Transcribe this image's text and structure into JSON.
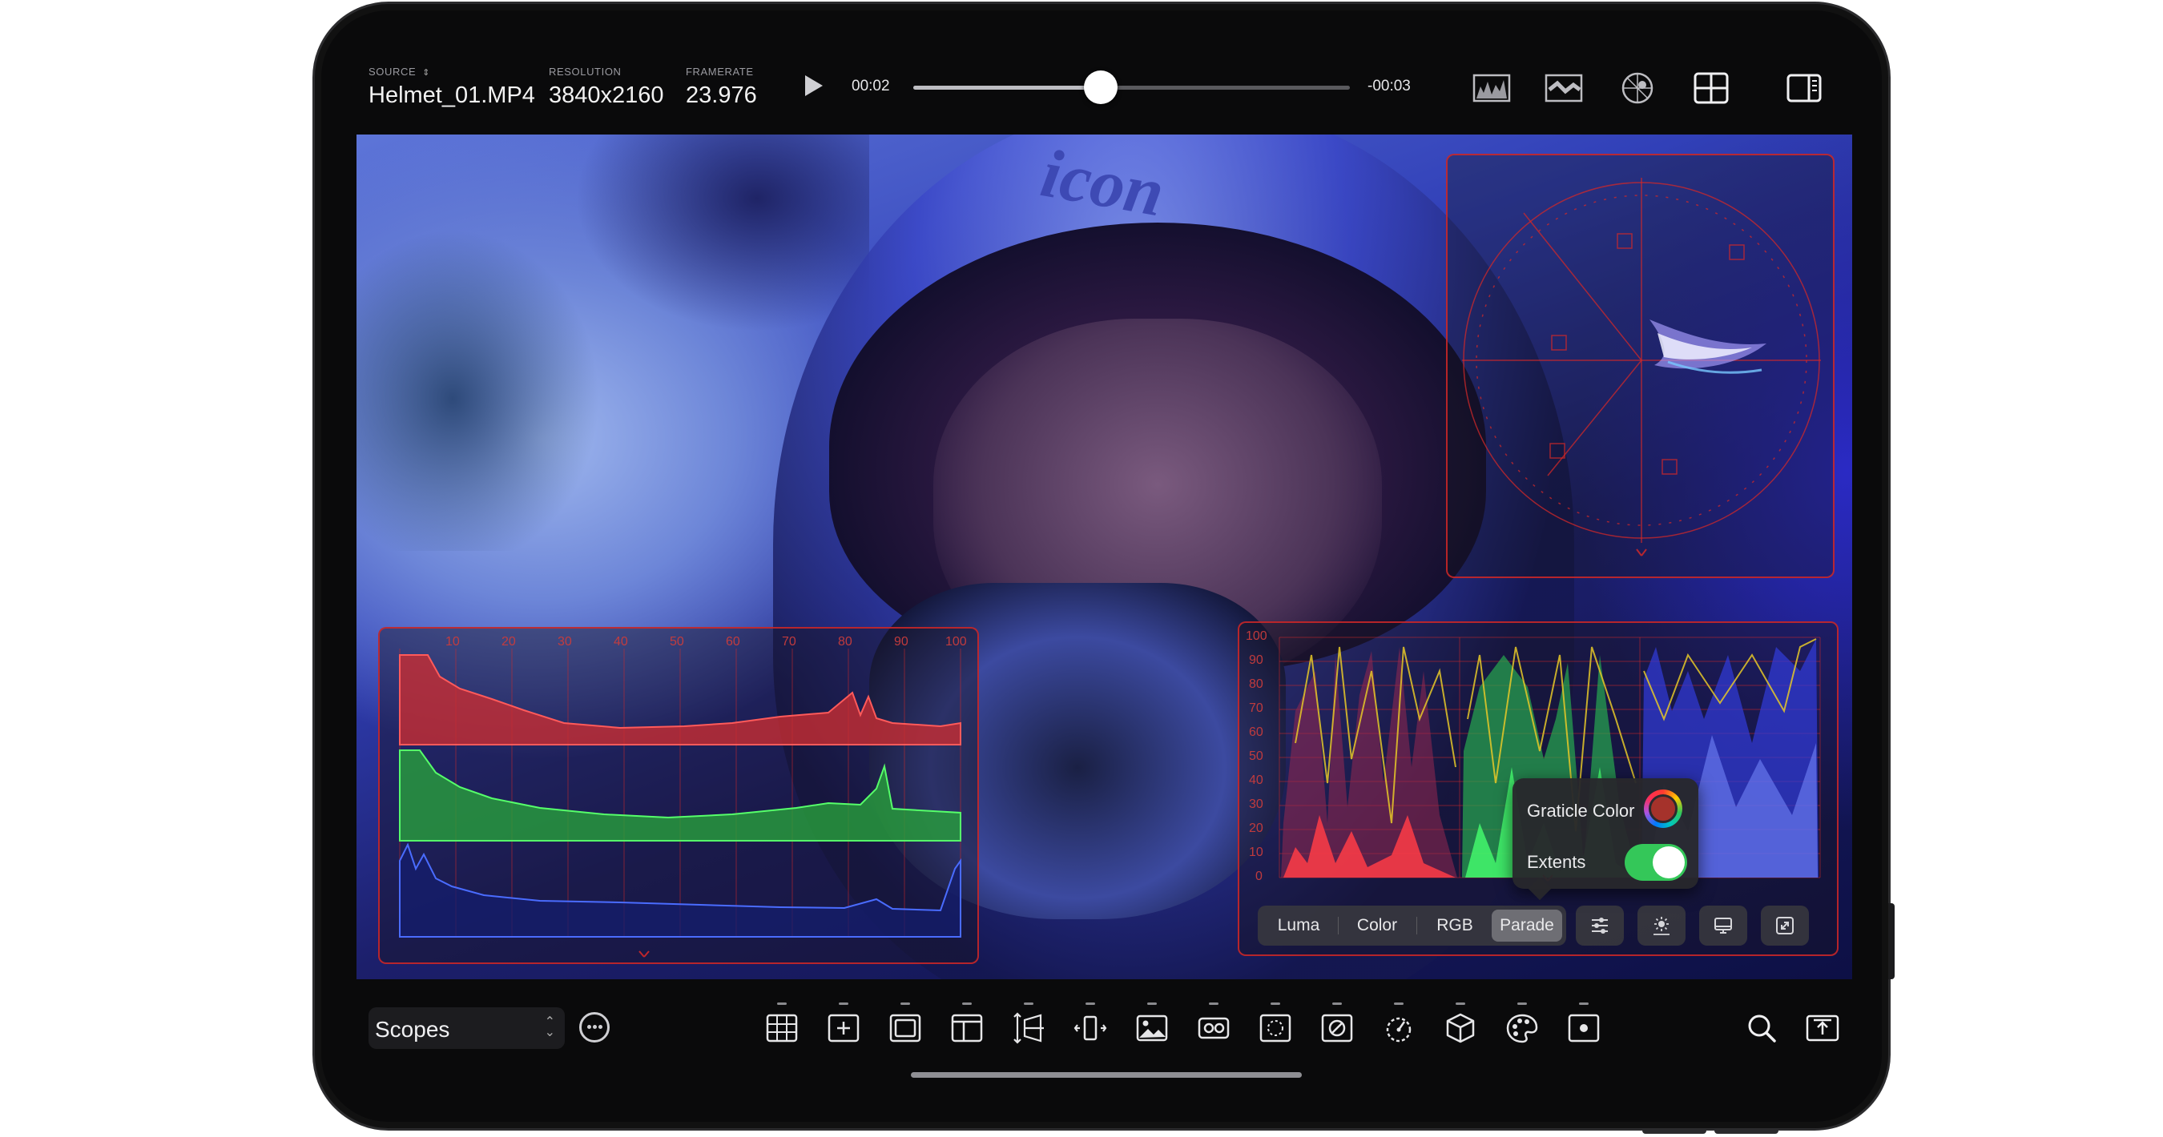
{
  "header": {
    "source": {
      "label": "SOURCE",
      "value": "Helmet_01.MP4"
    },
    "resolution": {
      "label": "RESOLUTION",
      "value": "3840x2160"
    },
    "framerate": {
      "label": "FRAMERATE",
      "value": "23.976"
    },
    "time_elapsed": "00:02",
    "time_remaining": "-00:03",
    "playhead_fraction": 0.43,
    "right_icons": [
      "waveform-icon",
      "parade-icon",
      "vectorscope-icon",
      "grid-layout-icon",
      "sidebar-icon"
    ]
  },
  "viewer": {
    "brand_text": "icon"
  },
  "histogram": {
    "top_labels": [
      "10",
      "20",
      "30",
      "40",
      "50",
      "60",
      "70",
      "80",
      "90",
      "100"
    ]
  },
  "parade": {
    "y_labels": [
      "100",
      "90",
      "80",
      "70",
      "60",
      "50",
      "40",
      "30",
      "20",
      "10",
      "0"
    ],
    "tabs": [
      "Luma",
      "Color",
      "RGB",
      "Parade"
    ],
    "active_tab": "Parade",
    "tool_icons": [
      "sliders-icon",
      "brightness-icon",
      "monitor-icon",
      "expand-icon"
    ],
    "popover": {
      "graticle_label": "Graticle Color",
      "graticle_color": "#a5322b",
      "extents_label": "Extents",
      "extents_on": true
    }
  },
  "bottom_bar": {
    "mode": "Scopes",
    "tools": [
      "grid-icon",
      "crosshair-icon",
      "frame-icon",
      "safe-area-icon",
      "perspective-icon",
      "flip-icon",
      "image-icon",
      "glasses-icon",
      "lasso-icon",
      "cancel-circle-icon",
      "dial-icon",
      "cube-icon",
      "palette-icon",
      "record-icon"
    ],
    "right_icons": [
      "search-icon",
      "export-icon"
    ]
  },
  "colors": {
    "graticule": "#d22828",
    "accent_green": "#34c759",
    "background": "#0a0a0b"
  }
}
